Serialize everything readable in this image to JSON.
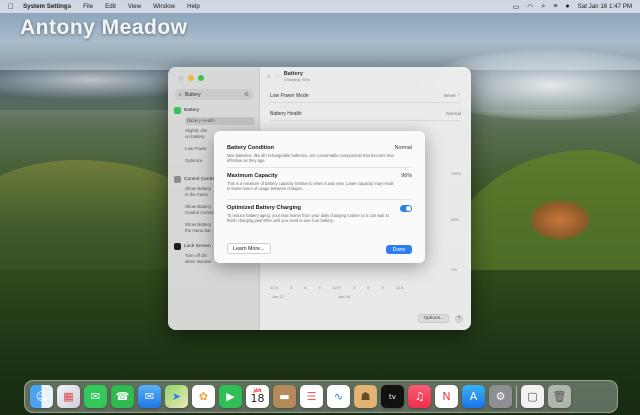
{
  "menubar": {
    "app_name": "System Settings",
    "items": [
      "File",
      "Edit",
      "View",
      "Window",
      "Help"
    ],
    "clock": "Sat Jan 16  1:47 PM"
  },
  "desktop": {
    "user_name": "Antony Meadow"
  },
  "settings": {
    "search_value": "Battery",
    "sidebar": {
      "battery_label": "Battery",
      "battery_health": "Battery Health",
      "slightly_text_1": "Slightly dim",
      "slightly_text_2": "on battery",
      "low_power": "Low Power",
      "optimize": "Optimize",
      "control_centre": "Control Centre",
      "show_battery_1": "Show Battery",
      "show_battery_2": "in the menu",
      "show_battery_3": "Show Battery",
      "show_battery_4": "Control Centre",
      "show_battery_5": "Show Battery",
      "show_battery_6": "the menu bar",
      "lock_screen": "Lock Screen",
      "turn_off_1": "Turn off dis",
      "turn_off_2": "when inactive"
    },
    "header": {
      "title": "Battery",
      "subtitle": "Charging: 98%"
    },
    "low_power_mode": {
      "label": "Low Power Mode",
      "value": "Never"
    },
    "battery_health": {
      "label": "Battery Health",
      "value": "Normal"
    },
    "chart": {
      "y_labels": [
        "100%",
        "50%",
        "0%"
      ],
      "x_labels": [
        "Jan 17",
        "Jan 18"
      ],
      "time_labels": [
        "12 A",
        "3",
        "6",
        "9",
        "12 P",
        "3",
        "6",
        "9",
        "12 A"
      ]
    },
    "options_label": "Options...",
    "help_label": "?"
  },
  "sheet": {
    "condition": {
      "label": "Battery Condition",
      "value": "Normal",
      "desc": "Mac batteries, like all rechargeable batteries, are consumable components that become less effective as they age."
    },
    "capacity": {
      "label": "Maximum Capacity",
      "value": "96%",
      "desc": "This is a measure of battery capacity relative to when it was new. Lower capacity may result in fewer hours of usage between charges."
    },
    "optimized": {
      "label": "Optimized Battery Charging",
      "desc": "To reduce battery aging, your Mac learns from your daily charging routine so it can wait to finish charging past 80% until you need to use it on battery.",
      "enabled": true
    },
    "learn_more": "Learn More...",
    "done": "Done"
  },
  "dock": {
    "calendar_month": "JAN",
    "calendar_day": "18",
    "icons": [
      "finder-icon",
      "launchpad-icon",
      "messages-icon",
      "facetime-icon",
      "mail-icon",
      "maps-icon",
      "photos-icon",
      "facetime-video-icon",
      "calendar-icon",
      "notes-folder-icon",
      "reminders-icon",
      "freeform-icon",
      "contacts-icon",
      "appletv-icon",
      "music-icon",
      "news-icon",
      "appstore-icon",
      "system-settings-icon",
      "preview-icon",
      "trash-icon"
    ]
  },
  "colors": {
    "accent": "#2f7ef0",
    "toggle_on": "#2f7ef0"
  }
}
